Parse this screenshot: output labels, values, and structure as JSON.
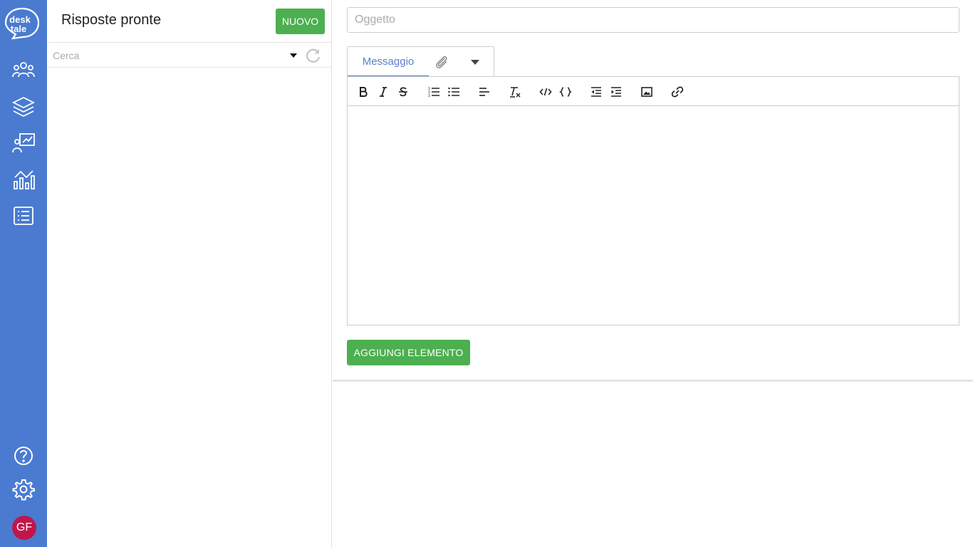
{
  "app": {
    "logo_text_line1": "desk",
    "logo_text_line2": "tale",
    "rail_color": "#4a7bd0"
  },
  "rail": {
    "top_items": [
      {
        "icon": "users-icon"
      },
      {
        "icon": "layers-icon"
      },
      {
        "icon": "presentation-chart-icon"
      },
      {
        "icon": "analytics-icon"
      },
      {
        "icon": "list-icon"
      }
    ],
    "bottom_items": [
      {
        "icon": "help-icon"
      },
      {
        "icon": "gear-icon"
      }
    ],
    "avatar_initials": "GF",
    "avatar_color": "#c0164a"
  },
  "panel": {
    "title": "Risposte pronte",
    "new_button_label": "NUOVO",
    "search_placeholder": "Cerca",
    "accent_green": "#4caf50"
  },
  "editor": {
    "subject_placeholder": "Oggetto",
    "tabs": [
      {
        "label": "Messaggio",
        "active": true
      }
    ],
    "toolbar": [
      "bold",
      "italic",
      "strikethrough",
      "ordered-list",
      "bullet-list",
      "align-left",
      "clear-format",
      "code",
      "code-block",
      "outdent",
      "indent",
      "image",
      "link"
    ],
    "add_button_label": "AGGIUNGI ELEMENTO"
  }
}
